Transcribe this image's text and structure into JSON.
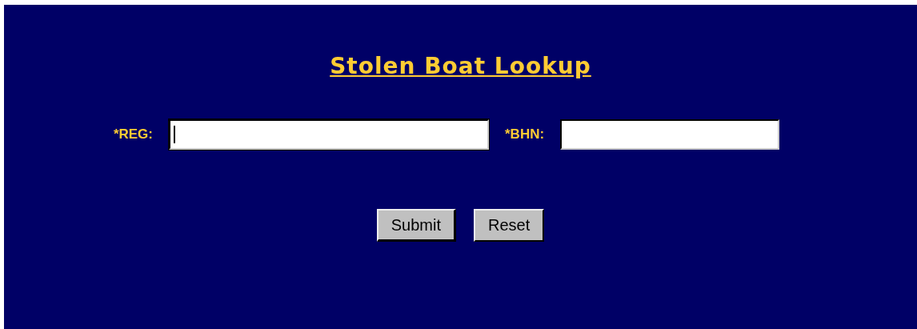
{
  "title": "Stolen Boat Lookup",
  "fields": [
    {
      "label": "*REG:",
      "focused": true
    },
    {
      "label": "*BHN:",
      "focused": false
    }
  ],
  "buttons": [
    {
      "label": "Submit",
      "default": true
    },
    {
      "label": "Reset",
      "default": false
    }
  ]
}
